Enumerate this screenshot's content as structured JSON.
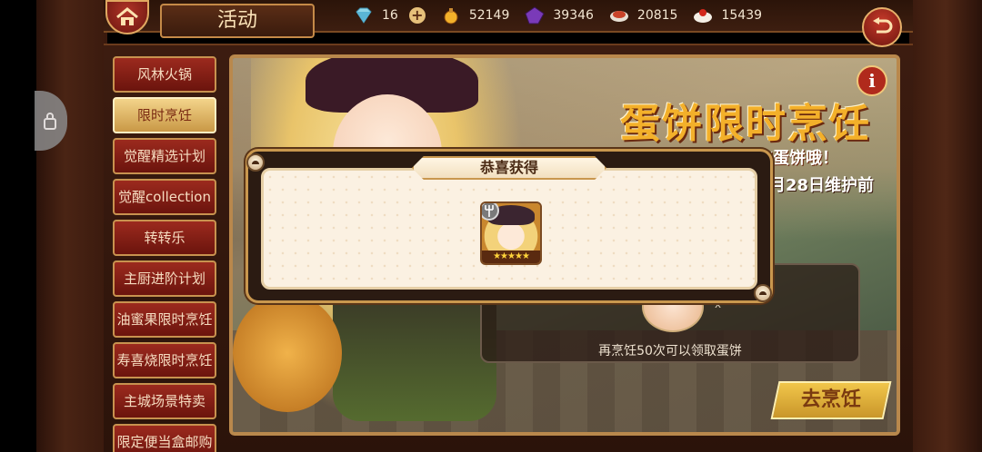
{
  "header": {
    "title": "活动",
    "resources": [
      {
        "icon": "diamond-icon",
        "value": "16"
      },
      {
        "icon": "gold-potion-icon",
        "value": "52149"
      },
      {
        "icon": "purple-crystal-icon",
        "value": "39346"
      },
      {
        "icon": "food-bowl-icon",
        "value": "20815"
      },
      {
        "icon": "food-cake-icon",
        "value": "15439"
      }
    ]
  },
  "sidebar": {
    "items": [
      {
        "label": "风林火锅"
      },
      {
        "label": "限时烹饪"
      },
      {
        "label": "觉醒精选计划"
      },
      {
        "label": "觉醒collection"
      },
      {
        "label": "转转乐"
      },
      {
        "label": "主厨进阶计划"
      },
      {
        "label": "油蜜果限时烹饪"
      },
      {
        "label": "寿喜烧限时烹饪"
      },
      {
        "label": "主城场景特卖"
      },
      {
        "label": "限定便当盒邮购"
      }
    ],
    "active_index": 1
  },
  "banner": {
    "title": "蛋饼限时烹饪",
    "subtitle": "额外的蛋饼哦！",
    "date": "月28日维护前",
    "info_label": "i",
    "progress_text": "再烹饪50次可以领取蛋饼",
    "mini_count": "x",
    "go_button": "去烹饪"
  },
  "popup": {
    "title": "恭喜获得",
    "reward": {
      "stars": 5,
      "stars_text": "★★★★★"
    }
  }
}
